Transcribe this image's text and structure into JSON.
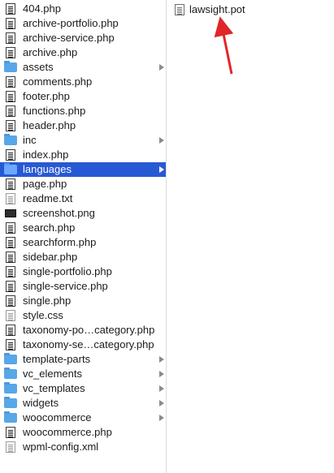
{
  "sidebar": {
    "items": [
      {
        "label": "404.php",
        "type": "php"
      },
      {
        "label": "archive-portfolio.php",
        "type": "php"
      },
      {
        "label": "archive-service.php",
        "type": "php"
      },
      {
        "label": "archive.php",
        "type": "php"
      },
      {
        "label": "assets",
        "type": "folder"
      },
      {
        "label": "comments.php",
        "type": "php"
      },
      {
        "label": "footer.php",
        "type": "php"
      },
      {
        "label": "functions.php",
        "type": "php"
      },
      {
        "label": "header.php",
        "type": "php"
      },
      {
        "label": "inc",
        "type": "folder"
      },
      {
        "label": "index.php",
        "type": "php"
      },
      {
        "label": "languages",
        "type": "folder",
        "selected": true
      },
      {
        "label": "page.php",
        "type": "php"
      },
      {
        "label": "readme.txt",
        "type": "txt"
      },
      {
        "label": "screenshot.png",
        "type": "png"
      },
      {
        "label": "search.php",
        "type": "php"
      },
      {
        "label": "searchform.php",
        "type": "php"
      },
      {
        "label": "sidebar.php",
        "type": "php"
      },
      {
        "label": "single-portfolio.php",
        "type": "php"
      },
      {
        "label": "single-service.php",
        "type": "php"
      },
      {
        "label": "single.php",
        "type": "php"
      },
      {
        "label": "style.css",
        "type": "css"
      },
      {
        "label": "taxonomy-po…category.php",
        "type": "php"
      },
      {
        "label": "taxonomy-se…category.php",
        "type": "php"
      },
      {
        "label": "template-parts",
        "type": "folder"
      },
      {
        "label": "vc_elements",
        "type": "folder"
      },
      {
        "label": "vc_templates",
        "type": "folder"
      },
      {
        "label": "widgets",
        "type": "folder"
      },
      {
        "label": "woocommerce",
        "type": "folder"
      },
      {
        "label": "woocommerce.php",
        "type": "php"
      },
      {
        "label": "wpml-config.xml",
        "type": "xml"
      }
    ]
  },
  "detail": {
    "file_label": "lawsight.pot"
  },
  "colors": {
    "selection": "#2859d4",
    "folder": "#58a7e8",
    "annotation_arrow": "#e0262b"
  }
}
